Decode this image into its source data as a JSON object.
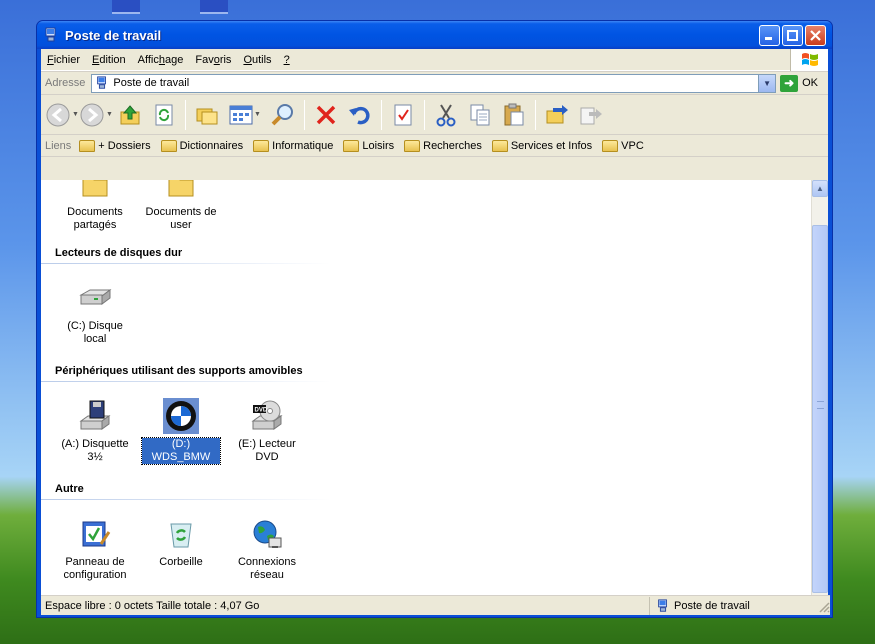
{
  "window": {
    "title": "Poste de travail"
  },
  "menu": {
    "items": [
      {
        "label": "Fichier",
        "u": "F",
        "rest": "ichier"
      },
      {
        "label": "Edition",
        "u": "E",
        "rest": "dition"
      },
      {
        "label": "Affichage",
        "pre": "Affic",
        "u": "h",
        "rest": "age"
      },
      {
        "label": "Favoris",
        "pre": "Fav",
        "u": "o",
        "rest": "ris"
      },
      {
        "label": "Outils",
        "u": "O",
        "rest": "utils"
      },
      {
        "label": "?",
        "u": "?",
        "rest": ""
      }
    ]
  },
  "address": {
    "label": "Adresse",
    "value": "Poste de travail",
    "go_label": "OK"
  },
  "links": {
    "label": "Liens",
    "items": [
      "+ Dossiers",
      "Dictionnaires",
      "Informatique",
      "Loisirs",
      "Recherches",
      "Services et Infos",
      "VPC"
    ]
  },
  "groups": {
    "top": {
      "items": [
        "Documents partagés",
        "Documents de user"
      ]
    },
    "hard": {
      "title": "Lecteurs de disques dur",
      "items": [
        "(C:) Disque local"
      ]
    },
    "removable": {
      "title": "Périphériques utilisant des supports amovibles",
      "items": [
        "(A:) Disquette 3½",
        "(D:) WDS_BMW",
        "(E:) Lecteur DVD"
      ]
    },
    "other": {
      "title": "Autre",
      "items": [
        "Panneau de configuration",
        "Corbeille",
        "Connexions réseau"
      ]
    }
  },
  "status": {
    "left": "Espace libre : 0 octets Taille totale : 4,07 Go",
    "right": "Poste de travail"
  }
}
